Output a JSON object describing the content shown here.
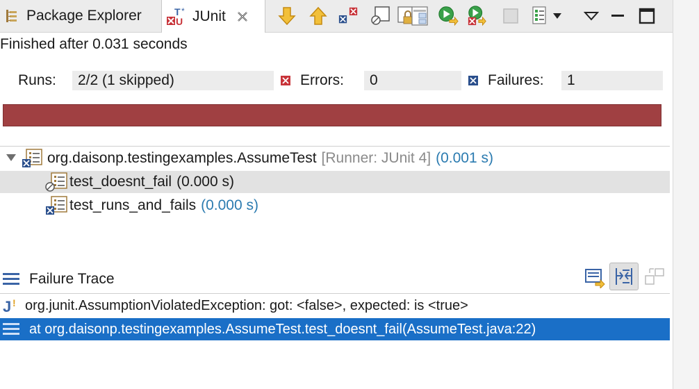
{
  "tabs": {
    "package_explorer": "Package Explorer",
    "junit": "JUnit"
  },
  "status": {
    "finished_text": "Finished after 0.031 seconds"
  },
  "counters": {
    "runs_label": "Runs:",
    "runs_value": "2/2 (1 skipped)",
    "errors_label": "Errors:",
    "errors_value": "0",
    "failures_label": "Failures:",
    "failures_value": "1"
  },
  "progress": {
    "fraction": 1.0,
    "color": "#a04042"
  },
  "tree": {
    "root_label": "org.daisonp.testingexamples.AssumeTest",
    "root_runner": "[Runner: JUnit 4]",
    "root_time": "(0.001 s)",
    "children": [
      {
        "label": "test_doesnt_fail",
        "time": "(0.000 s)",
        "status": "skipped"
      },
      {
        "label": "test_runs_and_fails",
        "time": "(0.000 s)",
        "status": "failed"
      }
    ]
  },
  "failure_trace": {
    "title": "Failure Trace",
    "lines": [
      "org.junit.AssumptionViolatedException: got: <false>, expected: is <true>",
      "at org.daisonp.testingexamples.AssumeTest.test_doesnt_fail(AssumeTest.java:22)"
    ]
  },
  "icons": {
    "package_explorer": "package-explorer-icon",
    "junit": "junit-icon",
    "close": "close-icon",
    "next_failure": "arrow-down-icon",
    "prev_failure": "arrow-up-icon",
    "show_failures_only": "failures-only-icon",
    "show_skipped_only": "skipped-only-icon",
    "scroll_lock": "lock-icon",
    "layout": "layout-icon",
    "rerun": "rerun-icon",
    "rerun_failed_first": "rerun-failed-icon",
    "stop": "stop-icon",
    "history": "history-icon",
    "view_menu": "view-menu-icon",
    "minimize": "minimize-icon",
    "maximize": "maximize-icon"
  },
  "colors": {
    "accent_selection": "#1a6fc7",
    "failure_bar": "#a04042",
    "time_text": "#2b7bb0"
  }
}
